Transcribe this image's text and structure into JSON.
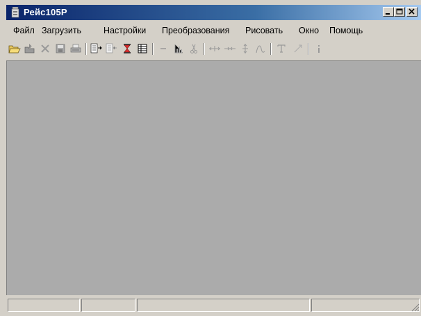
{
  "window": {
    "title": "Рейс105Р",
    "controls": {
      "minimize_icon": "minimize-icon",
      "maximize_icon": "maximize-icon",
      "close_icon": "close-icon"
    }
  },
  "menu": {
    "items": [
      "Файл",
      "Загрузить",
      "Настройки",
      "Преобразования",
      "Рисовать",
      "Окно",
      "Помощь"
    ]
  },
  "toolbar": {
    "buttons": [
      "open-folder-icon",
      "load-icon",
      "delete-icon",
      "save-icon",
      "print-icon",
      "export-icon",
      "import-icon",
      "hourglass-icon",
      "table-icon",
      "line-icon",
      "chart-icon",
      "cut-icon",
      "split-h-icon",
      "merge-h-icon",
      "split-v-icon",
      "curve-icon",
      "text-icon",
      "arrow-icon",
      "info-icon"
    ]
  },
  "colors": {
    "title_start": "#0a246a",
    "title_end": "#a6caf0",
    "client_bg": "#ababab",
    "face": "#d4d0c8"
  },
  "statusbar": {
    "panels": [
      "",
      "",
      "",
      ""
    ]
  }
}
